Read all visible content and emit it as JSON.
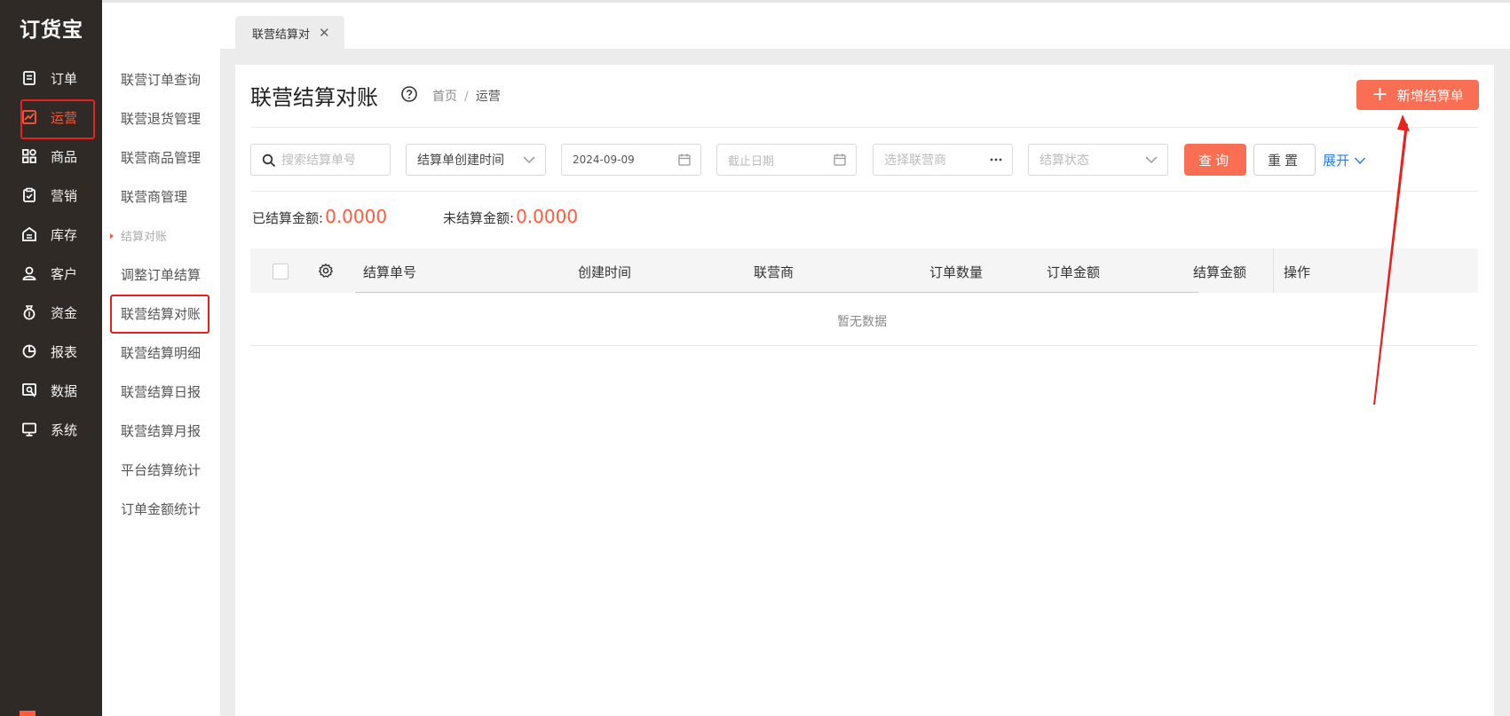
{
  "app": {
    "logo": "订货宝"
  },
  "nav": [
    {
      "label": "订单",
      "icon": "order-icon"
    },
    {
      "label": "运营",
      "icon": "operation-chart-icon",
      "active": true
    },
    {
      "label": "商品",
      "icon": "goods-grid-icon"
    },
    {
      "label": "营销",
      "icon": "marketing-clipboard-icon"
    },
    {
      "label": "库存",
      "icon": "warehouse-icon"
    },
    {
      "label": "客户",
      "icon": "customer-user-icon"
    },
    {
      "label": "资金",
      "icon": "money-bag-icon"
    },
    {
      "label": "报表",
      "icon": "pie-report-icon"
    },
    {
      "label": "数据",
      "icon": "data-search-icon"
    },
    {
      "label": "系统",
      "icon": "monitor-icon"
    }
  ],
  "subnav": [
    {
      "label": "联营订单查询"
    },
    {
      "label": "联营退货管理"
    },
    {
      "label": "联营商品管理"
    },
    {
      "label": "联营商管理"
    },
    {
      "label": "结算对账",
      "group": true
    },
    {
      "label": "调整订单结算"
    },
    {
      "label": "联营结算对账",
      "current": true
    },
    {
      "label": "联营结算明细"
    },
    {
      "label": "联营结算日报"
    },
    {
      "label": "联营结算月报"
    },
    {
      "label": "平台结算统计"
    },
    {
      "label": "订单金额统计"
    }
  ],
  "tab": {
    "label": "联营结算对"
  },
  "page": {
    "title": "联营结算对账",
    "breadcrumb": {
      "home": "首页",
      "sep": "/",
      "current": "运营"
    },
    "add_button": "新增结算单"
  },
  "filters": {
    "search_placeholder": "搜索结算单号",
    "time_type": "结算单创建时间",
    "start_date": "2024-09-09",
    "end_placeholder": "截止日期",
    "partner_placeholder": "选择联营商",
    "status_placeholder": "结算状态",
    "query": "查询",
    "reset": "重置",
    "expand": "展开"
  },
  "summary": {
    "settled_label": "已结算金额:",
    "settled_value": "0.0000",
    "unsettled_label": "未结算金额:",
    "unsettled_value": "0.0000"
  },
  "table": {
    "columns": [
      "结算单号",
      "创建时间",
      "联营商",
      "订单数量",
      "订单金额",
      "结算金额",
      "操作"
    ],
    "empty": "暂无数据"
  },
  "colors": {
    "accent": "#fa6e54",
    "sidebar": "#302a26",
    "link": "#2f7de1",
    "highlight": "#e8211c"
  }
}
